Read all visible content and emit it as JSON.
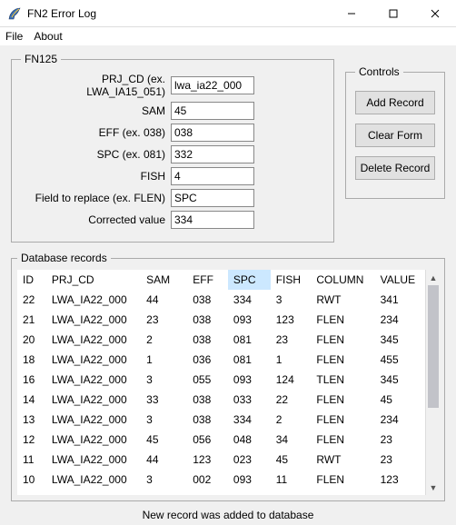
{
  "window": {
    "title": "FN2 Error Log"
  },
  "menu": {
    "file": "File",
    "about": "About"
  },
  "fn125": {
    "legend": "FN125",
    "prj_cd_label": "PRJ_CD (ex. LWA_IA15_051)",
    "prj_cd_value": "lwa_ia22_000",
    "sam_label": "SAM",
    "sam_value": "45",
    "eff_label": "EFF (ex. 038)",
    "eff_value": "038",
    "spc_label": "SPC (ex. 081)",
    "spc_value": "332",
    "fish_label": "FISH",
    "fish_value": "4",
    "field_label": "Field to replace (ex. FLEN)",
    "field_value": "SPC",
    "corrected_label": "Corrected value",
    "corrected_value": "334"
  },
  "controls": {
    "legend": "Controls",
    "add": "Add Record",
    "clear": "Clear Form",
    "delete": "Delete Record"
  },
  "db": {
    "legend": "Database records",
    "headers": {
      "id": "ID",
      "prj_cd": "PRJ_CD",
      "sam": "SAM",
      "eff": "EFF",
      "spc": "SPC",
      "fish": "FISH",
      "column": "COLUMN",
      "value": "VALUE"
    },
    "rows": [
      {
        "id": "22",
        "prj_cd": "LWA_IA22_000",
        "sam": "44",
        "eff": "038",
        "spc": "334",
        "fish": "3",
        "column": "RWT",
        "value": "341"
      },
      {
        "id": "21",
        "prj_cd": "LWA_IA22_000",
        "sam": "23",
        "eff": "038",
        "spc": "093",
        "fish": "123",
        "column": "FLEN",
        "value": "234"
      },
      {
        "id": "20",
        "prj_cd": "LWA_IA22_000",
        "sam": "2",
        "eff": "038",
        "spc": "081",
        "fish": "23",
        "column": "FLEN",
        "value": "345"
      },
      {
        "id": "18",
        "prj_cd": "LWA_IA22_000",
        "sam": "1",
        "eff": "036",
        "spc": "081",
        "fish": "1",
        "column": "FLEN",
        "value": "455"
      },
      {
        "id": "16",
        "prj_cd": "LWA_IA22_000",
        "sam": "3",
        "eff": "055",
        "spc": "093",
        "fish": "124",
        "column": "TLEN",
        "value": "345"
      },
      {
        "id": "14",
        "prj_cd": "LWA_IA22_000",
        "sam": "33",
        "eff": "038",
        "spc": "033",
        "fish": "22",
        "column": "FLEN",
        "value": "45"
      },
      {
        "id": "13",
        "prj_cd": "LWA_IA22_000",
        "sam": "3",
        "eff": "038",
        "spc": "334",
        "fish": "2",
        "column": "FLEN",
        "value": "234"
      },
      {
        "id": "12",
        "prj_cd": "LWA_IA22_000",
        "sam": "45",
        "eff": "056",
        "spc": "048",
        "fish": "34",
        "column": "FLEN",
        "value": "23"
      },
      {
        "id": "11",
        "prj_cd": "LWA_IA22_000",
        "sam": "44",
        "eff": "123",
        "spc": "023",
        "fish": "45",
        "column": "RWT",
        "value": "23"
      },
      {
        "id": "10",
        "prj_cd": "LWA_IA22_000",
        "sam": "3",
        "eff": "002",
        "spc": "093",
        "fish": "11",
        "column": "FLEN",
        "value": "123"
      }
    ]
  },
  "status": "New record was added to database"
}
